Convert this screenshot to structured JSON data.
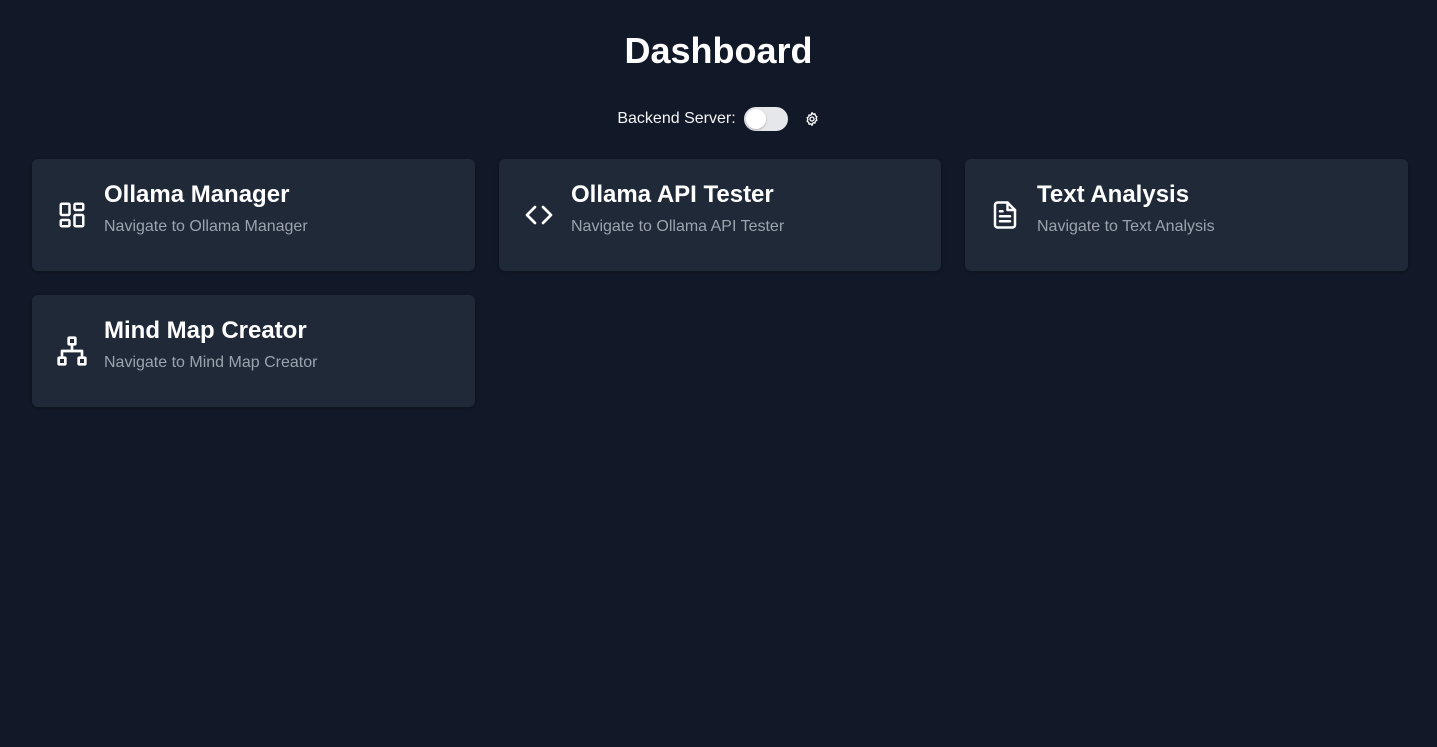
{
  "header": {
    "title": "Dashboard"
  },
  "server": {
    "label": "Backend Server:",
    "toggle_on": false,
    "settings_icon": "gear-icon"
  },
  "cards": [
    {
      "title": "Ollama Manager",
      "description": "Navigate to Ollama Manager",
      "icon": "dashboard-grid-icon"
    },
    {
      "title": "Ollama API Tester",
      "description": "Navigate to Ollama API Tester",
      "icon": "code-icon"
    },
    {
      "title": "Text Analysis",
      "description": "Navigate to Text Analysis",
      "icon": "document-icon"
    },
    {
      "title": "Mind Map Creator",
      "description": "Navigate to Mind Map Creator",
      "icon": "hierarchy-icon"
    }
  ],
  "colors": {
    "background": "#111827",
    "card": "#1f2937",
    "text": "#ffffff",
    "muted_text": "#9ca3af",
    "toggle_track": "#e5e7eb"
  }
}
